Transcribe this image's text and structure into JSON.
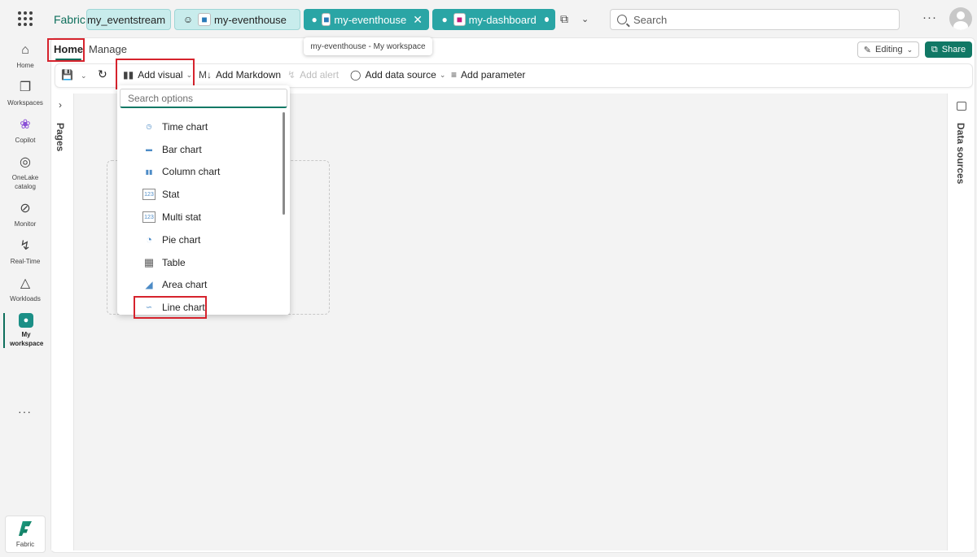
{
  "app": {
    "brand": "Fabric"
  },
  "tabs": [
    {
      "label": "my_eventstream",
      "style": "light",
      "icon": "eventstream-icon"
    },
    {
      "label": "my-eventhouse",
      "style": "light",
      "icon": "eventhouse-icon"
    },
    {
      "label": "my-eventhouse",
      "style": "dark",
      "icon": "eventhouse-icon",
      "close": "✕"
    },
    {
      "label": "my-dashboard",
      "style": "dark",
      "icon": "dashboard-icon"
    }
  ],
  "tooltip": "my-eventhouse - My workspace",
  "search": {
    "placeholder": "Search"
  },
  "rail": [
    {
      "label": "Home",
      "icon": "home-icon"
    },
    {
      "label": "Workspaces",
      "icon": "workspaces-icon"
    },
    {
      "label": "Copilot",
      "icon": "copilot-icon"
    },
    {
      "label": "OneLake catalog",
      "icon": "onelake-icon"
    },
    {
      "label": "Monitor",
      "icon": "monitor-icon"
    },
    {
      "label": "Real-Time",
      "icon": "realtime-icon"
    },
    {
      "label": "Workloads",
      "icon": "workloads-icon"
    },
    {
      "label": "My workspace",
      "icon": "my-workspace-icon"
    }
  ],
  "rail_bottom": {
    "label": "Fabric"
  },
  "ribbon": {
    "home": "Home",
    "manage": "Manage",
    "editing": "Editing",
    "share": "Share"
  },
  "toolbar": {
    "add_visual": "Add visual",
    "add_markdown": "Add Markdown",
    "add_alert": "Add alert",
    "add_data_source": "Add data source",
    "add_parameter": "Add parameter"
  },
  "side": {
    "pages": "Pages",
    "data_sources": "Data sources"
  },
  "dropdown": {
    "search_placeholder": "Search options",
    "items": [
      {
        "label": "Time chart",
        "icon": "time-chart-icon"
      },
      {
        "label": "Bar chart",
        "icon": "bar-chart-icon"
      },
      {
        "label": "Column chart",
        "icon": "column-chart-icon"
      },
      {
        "label": "Stat",
        "icon": "stat-icon"
      },
      {
        "label": "Multi stat",
        "icon": "multi-stat-icon"
      },
      {
        "label": "Pie chart",
        "icon": "pie-chart-icon"
      },
      {
        "label": "Table",
        "icon": "table-icon"
      },
      {
        "label": "Area chart",
        "icon": "area-chart-icon"
      },
      {
        "label": "Line chart",
        "icon": "line-chart-icon"
      }
    ]
  },
  "colors": {
    "accent": "#117865",
    "highlight": "#d6232d",
    "tab_dark": "#2aa5a5",
    "tab_light": "#c8ecec"
  }
}
